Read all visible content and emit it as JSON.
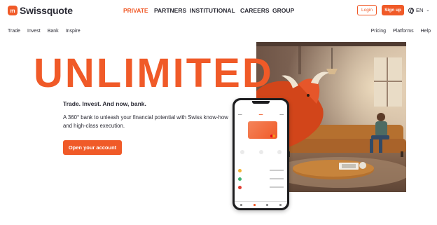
{
  "brand": {
    "logo_mark": "m",
    "name": "Swissquote"
  },
  "main_nav": [
    {
      "label": "PRIVATE",
      "active": true
    },
    {
      "label": "PARTNERS",
      "active": false
    },
    {
      "label": "INSTITUTIONAL",
      "active": false
    },
    {
      "label": "CAREERS",
      "active": false
    },
    {
      "label": "GROUP",
      "active": false
    }
  ],
  "header_actions": {
    "login_label": "Login",
    "signup_label": "Sign up",
    "language": "EN"
  },
  "sub_nav_left": [
    "Trade",
    "Invest",
    "Bank",
    "Inspire"
  ],
  "sub_nav_right": [
    "Pricing",
    "Platforms",
    "Help"
  ],
  "hero": {
    "headline": "UNLIMITED",
    "tagline": "Trade. Invest. And now, bank.",
    "description": "A 360° bank to unleash your financial potential with Swiss know-how and high-class execution.",
    "cta_label": "Open your account"
  },
  "colors": {
    "accent": "#f05a28",
    "text": "#2b2b35"
  }
}
